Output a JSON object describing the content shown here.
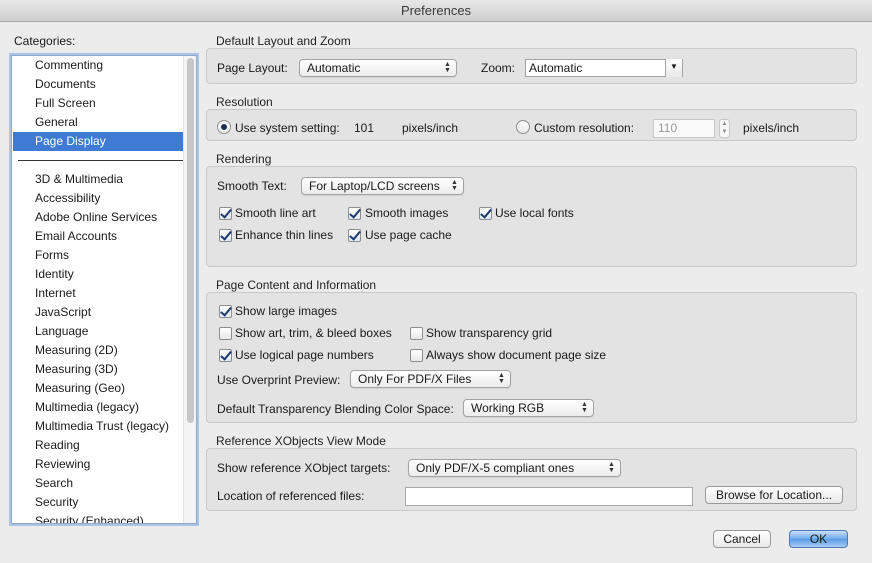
{
  "window": {
    "title": "Preferences"
  },
  "sidebar": {
    "label": "Categories:",
    "top_items": [
      "Commenting",
      "Documents",
      "Full Screen",
      "General",
      "Page Display"
    ],
    "selected": "Page Display",
    "items": [
      "3D & Multimedia",
      "Accessibility",
      "Adobe Online Services",
      "Email Accounts",
      "Forms",
      "Identity",
      "Internet",
      "JavaScript",
      "Language",
      "Measuring (2D)",
      "Measuring (3D)",
      "Measuring (Geo)",
      "Multimedia (legacy)",
      "Multimedia Trust (legacy)",
      "Reading",
      "Reviewing",
      "Search",
      "Security",
      "Security (Enhanced)"
    ]
  },
  "layout_zoom": {
    "title": "Default Layout and Zoom",
    "page_layout_label": "Page Layout:",
    "page_layout_value": "Automatic",
    "zoom_label": "Zoom:",
    "zoom_value": "Automatic"
  },
  "resolution": {
    "title": "Resolution",
    "system_label": "Use system setting:",
    "system_value": "101",
    "system_unit": "pixels/inch",
    "custom_label": "Custom resolution:",
    "custom_value": "110",
    "custom_unit": "pixels/inch",
    "selected": "system"
  },
  "rendering": {
    "title": "Rendering",
    "smooth_text_label": "Smooth Text:",
    "smooth_text_value": "For Laptop/LCD screens",
    "checkboxes": {
      "smooth_line_art": {
        "label": "Smooth line art",
        "checked": true
      },
      "smooth_images": {
        "label": "Smooth images",
        "checked": true
      },
      "use_local_fonts": {
        "label": "Use local fonts",
        "checked": true
      },
      "enhance_thin_lines": {
        "label": "Enhance thin lines",
        "checked": true
      },
      "use_page_cache": {
        "label": "Use page cache",
        "checked": true
      }
    }
  },
  "page_content": {
    "title": "Page Content and Information",
    "checkboxes": {
      "show_large_images": {
        "label": "Show large images",
        "checked": true
      },
      "show_boxes": {
        "label": "Show art, trim, & bleed boxes",
        "checked": false
      },
      "show_transparency_grid": {
        "label": "Show transparency grid",
        "checked": false
      },
      "use_logical_page_numbers": {
        "label": "Use logical page numbers",
        "checked": true
      },
      "always_show_page_size": {
        "label": "Always show document page size",
        "checked": false
      }
    },
    "overprint_label": "Use Overprint Preview:",
    "overprint_value": "Only For PDF/X Files",
    "blending_label": "Default Transparency Blending Color Space:",
    "blending_value": "Working RGB"
  },
  "xobjects": {
    "title": "Reference XObjects View Mode",
    "targets_label": "Show reference XObject targets:",
    "targets_value": "Only PDF/X-5 compliant ones",
    "location_label": "Location of referenced files:",
    "location_value": "",
    "browse_label": "Browse for Location..."
  },
  "footer": {
    "cancel_label": "Cancel",
    "ok_label": "OK"
  },
  "colors": {
    "selection": "#3f7ad5",
    "ok_button": "#6fa8ea"
  }
}
